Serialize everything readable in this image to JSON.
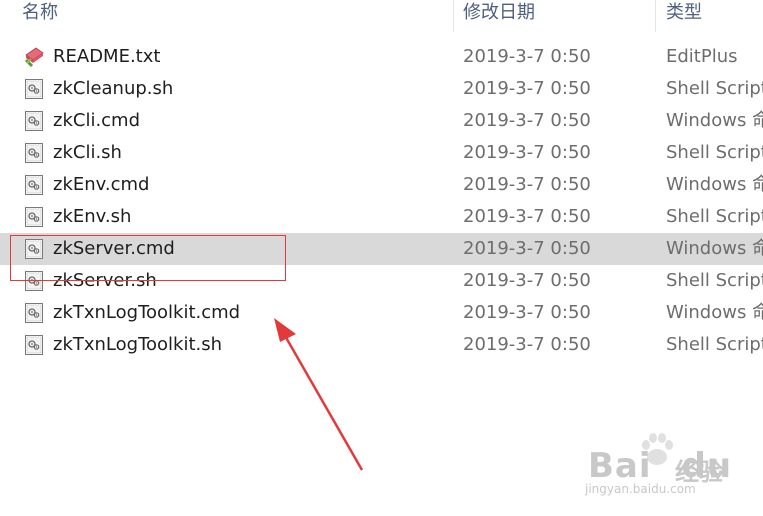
{
  "columns": {
    "name": "名称",
    "date_modified": "修改日期",
    "type": "类型"
  },
  "files": [
    {
      "name": "README.txt",
      "date": "2019-3-7 0:50",
      "type": "EditPlus",
      "icon": "editplus-file-icon"
    },
    {
      "name": "zkCleanup.sh",
      "date": "2019-3-7 0:50",
      "type": "Shell Script",
      "icon": "script-file-icon"
    },
    {
      "name": "zkCli.cmd",
      "date": "2019-3-7 0:50",
      "type": "Windows 命令脚本",
      "icon": "script-file-icon"
    },
    {
      "name": "zkCli.sh",
      "date": "2019-3-7 0:50",
      "type": "Shell Script",
      "icon": "script-file-icon"
    },
    {
      "name": "zkEnv.cmd",
      "date": "2019-3-7 0:50",
      "type": "Windows 命令脚本",
      "icon": "script-file-icon"
    },
    {
      "name": "zkEnv.sh",
      "date": "2019-3-7 0:50",
      "type": "Shell Script",
      "icon": "script-file-icon"
    },
    {
      "name": "zkServer.cmd",
      "date": "2019-3-7 0:50",
      "type": "Windows 命令脚本",
      "icon": "script-file-icon",
      "selected": true
    },
    {
      "name": "zkServer.sh",
      "date": "2019-3-7 0:50",
      "type": "Shell Script",
      "icon": "script-file-icon"
    },
    {
      "name": "zkTxnLogToolkit.cmd",
      "date": "2019-3-7 0:50",
      "type": "Windows 命令脚本",
      "icon": "script-file-icon"
    },
    {
      "name": "zkTxnLogToolkit.sh",
      "date": "2019-3-7 0:50",
      "type": "Shell Script",
      "icon": "script-file-icon"
    }
  ],
  "watermark": {
    "brand": "Bai",
    "brand_suffix": "du",
    "cn": "经验",
    "url": "jingyan.baidu.com"
  },
  "colors": {
    "selection": "#d9d9d9",
    "annotation": "#e23a3a",
    "header_text": "#4d6082"
  }
}
